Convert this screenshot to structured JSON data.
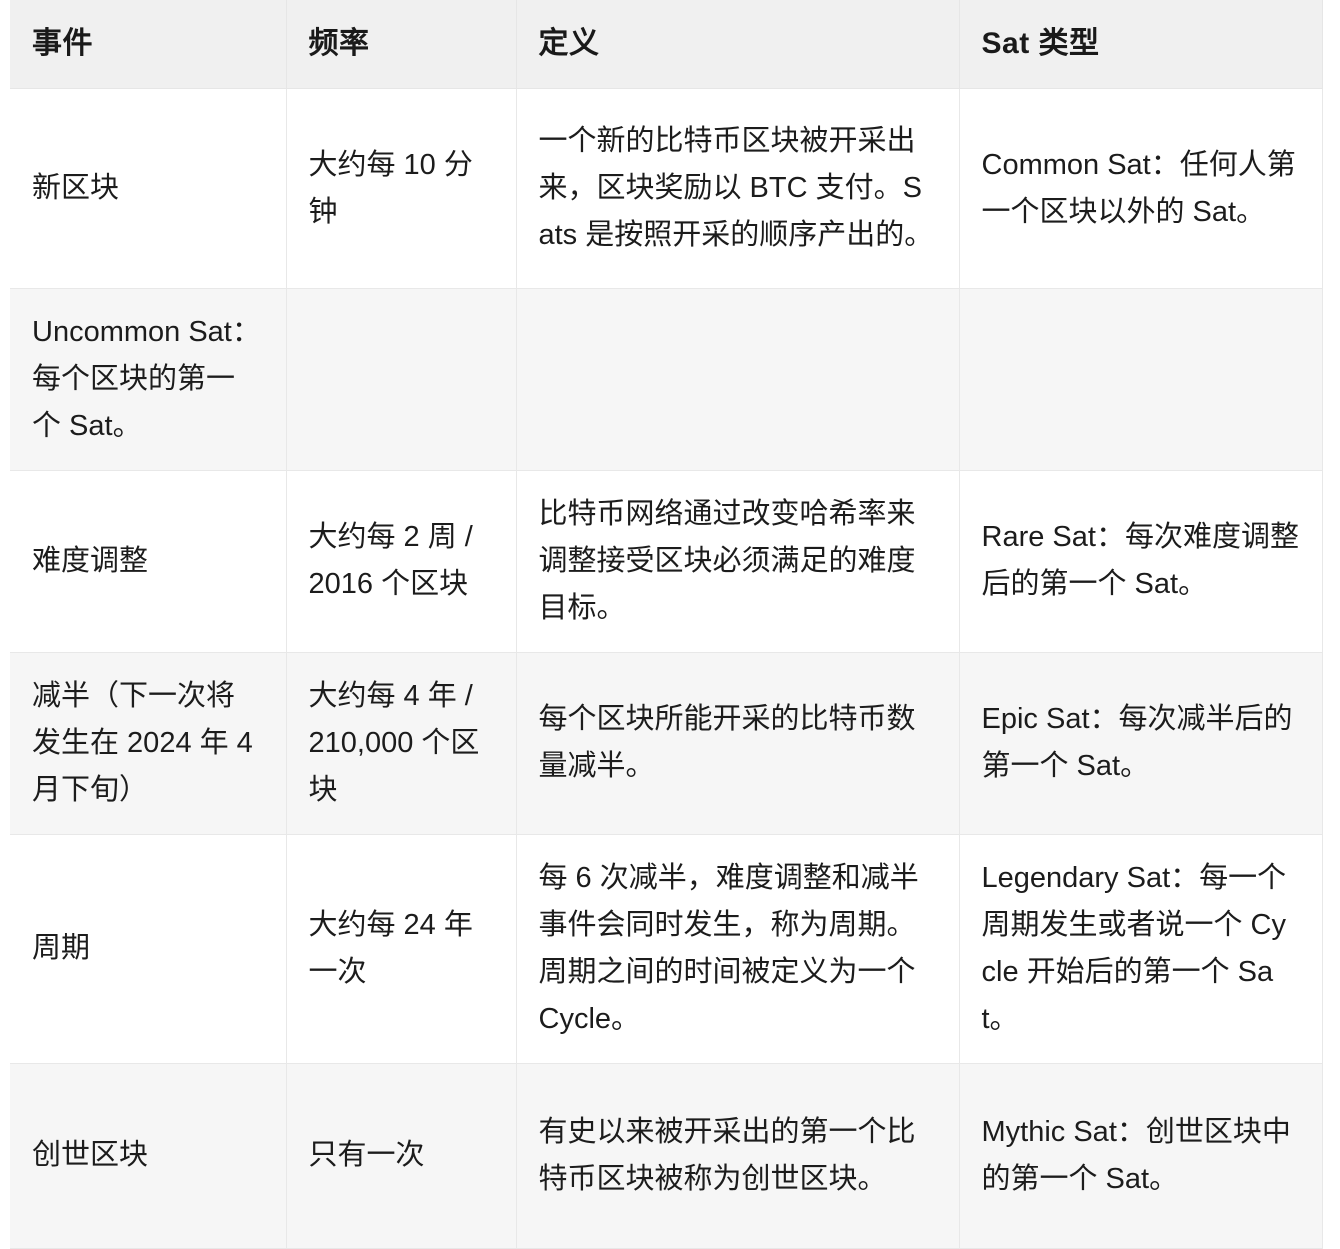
{
  "table": {
    "columns": [
      {
        "key": "event",
        "label": "事件"
      },
      {
        "key": "frequency",
        "label": "频率"
      },
      {
        "key": "definition",
        "label": "定义"
      },
      {
        "key": "sat_type",
        "label": "Sat 类型"
      }
    ],
    "rows": [
      {
        "event": "新区块",
        "frequency": "大约每 10 分钟",
        "definition": "一个新的比特币区块被开采出来，区块奖励以 BTC 支付。Sats 是按照开采的顺序产出的。",
        "sat_type": "Common Sat：任何人第一个区块以外的 Sat。",
        "shaded": false
      },
      {
        "event": "Uncommon Sat：每个区块的第一个 Sat。",
        "frequency": "",
        "definition": "",
        "sat_type": "",
        "shaded": true
      },
      {
        "event": "难度调整",
        "frequency": "大约每 2 周 / 2016 个区块",
        "definition": "比特币网络通过改变哈希率来调整接受区块必须满足的难度目标。",
        "sat_type": "Rare Sat：每次难度调整后的第一个 Sat。",
        "shaded": false
      },
      {
        "event": "减半（下一次将发生在 2024 年 4 月下旬）",
        "frequency": "大约每 4 年 / 210,000 个区块",
        "definition": "每个区块所能开采的比特币数量减半。",
        "sat_type": "Epic Sat：每次减半后的第一个 Sat。",
        "shaded": true
      },
      {
        "event": "周期",
        "frequency": "大约每 24 年一次",
        "definition": "每 6 次减半，难度调整和减半事件会同时发生，称为周期。周期之间的时间被定义为一个 Cycle。",
        "sat_type": "Legendary Sat：每一个周期发生或者说一个 Cycle 开始后的第一个 Sat。",
        "shaded": false
      },
      {
        "event": "创世区块",
        "frequency": "只有一次",
        "definition": "有史以来被开采出的第一个比特币区块被称为创世区块。",
        "sat_type": "Mythic Sat：创世区块中的第一个 Sat。",
        "shaded": true
      }
    ]
  },
  "colors": {
    "header_background": "#f0f0f0",
    "row_shaded_background": "#f6f6f6",
    "row_plain_background": "#ffffff",
    "border": "#e8e8e8",
    "text": "#1c1c1c"
  }
}
